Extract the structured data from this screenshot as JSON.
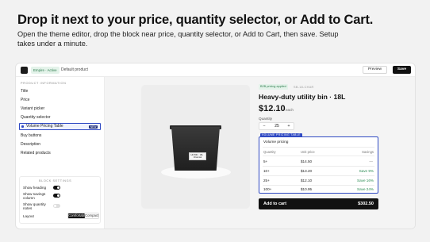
{
  "headline": "Drop it next to your price, quantity selector, or Add to Cart.",
  "subheadline": "Open the theme editor, drop the block near price, quantity selector, or Add to Cart, then save. Setup takes under a minute.",
  "editor": {
    "theme_badge": "Empire · Active",
    "product_name": "Default product",
    "preview_label": "Preview",
    "save_label": "Save"
  },
  "sidebar": {
    "section_title": "PRODUCT INFORMATION",
    "items": [
      {
        "label": "Title"
      },
      {
        "label": "Price"
      },
      {
        "label": "Variant picker"
      },
      {
        "label": "Quantity selector"
      },
      {
        "label": "Volume Pricing Table",
        "badge": "NEW",
        "active": true
      },
      {
        "label": "Buy buttons"
      },
      {
        "label": "Description"
      },
      {
        "label": "Related products"
      }
    ],
    "block_settings_title": "BLOCK SETTINGS",
    "settings": [
      {
        "label": "Show heading",
        "on": true
      },
      {
        "label": "Show savings column",
        "on": true
      },
      {
        "label": "Show quantity notes",
        "on": false
      }
    ],
    "layout_label": "Layout",
    "layout_options": [
      "Comfortable",
      "Compact"
    ],
    "layout_selected": "Comfortable"
  },
  "product": {
    "image_label": "HD BIN · 18L · Charcoal",
    "badge": "B2B pricing applied",
    "sku": "SB-18-CHAR",
    "title": "Heavy-duty utility bin · 18L",
    "price": "$12.10",
    "price_unit": "each",
    "quantity_label": "Quantity",
    "quantity_value": "25",
    "minus": "−",
    "plus": "+"
  },
  "volume_table": {
    "tag": "VOLUME PRICING TABLE",
    "title": "Volume pricing",
    "headers": {
      "quantity": "Quantity",
      "unit_price": "Unit price",
      "savings": "Savings"
    },
    "rows": [
      {
        "qty": "5+",
        "price": "$14.50",
        "savings": "—"
      },
      {
        "qty": "10+",
        "price": "$13.20",
        "savings": "Save 9%"
      },
      {
        "qty": "25+",
        "price": "$12.10",
        "savings": "Save 16%"
      },
      {
        "qty": "100+",
        "price": "$10.95",
        "savings": "Save 24%"
      }
    ]
  },
  "cart": {
    "label": "Add to cart",
    "total": "$302.50"
  },
  "colors": {
    "accent": "#2f49c3",
    "savings_green": "#2a8a52",
    "primary_dark": "#111111"
  }
}
